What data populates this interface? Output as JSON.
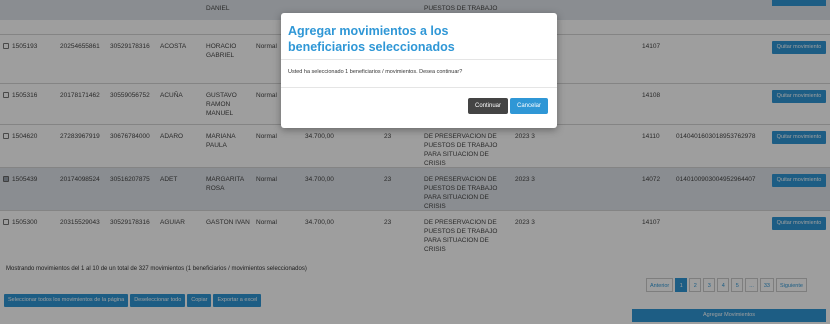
{
  "top_row": {
    "name": "DANIEL",
    "program": "PUESTOS DE TRABAJO"
  },
  "rows": [
    {
      "id": "1505193",
      "cuil": "20254655861",
      "cuit": "30529178316",
      "apellido": "ACOSTA",
      "nombre": [
        "HORACIO",
        "GABRIEL"
      ],
      "tipo": "Normal",
      "monto": "",
      "cod": "",
      "programa": [],
      "periodo": "",
      "codigo": "14107",
      "cbu": "",
      "selected": false
    },
    {
      "id": "1505316",
      "cuil": "20178171462",
      "cuit": "30559056752",
      "apellido": "ACUÑA",
      "nombre": [
        "GUSTAVO",
        "RAMON",
        "MANUEL"
      ],
      "tipo": "Normal",
      "monto": "",
      "cod": "",
      "programa": [],
      "periodo": "",
      "codigo": "14108",
      "cbu": "",
      "selected": false
    },
    {
      "id": "1504620",
      "cuil": "27283967919",
      "cuit": "30676784000",
      "apellido": "ADARO",
      "nombre": [
        "MARIANA",
        "PAULA"
      ],
      "tipo": "Normal",
      "monto": "34.700,00",
      "cod": "23",
      "programa": [
        "DE PRESERVACION DE",
        "PUESTOS DE TRABAJO",
        "PARA SITUACION DE",
        "CRISIS"
      ],
      "periodo": "2023   3",
      "codigo": "14110",
      "cbu": "0140401603018953762978",
      "selected": false
    },
    {
      "id": "1505439",
      "cuil": "20174098524",
      "cuit": "30516207875",
      "apellido": "ADET",
      "nombre": [
        "MARGARITA",
        "ROSA"
      ],
      "tipo": "Normal",
      "monto": "34.700,00",
      "cod": "23",
      "programa": [
        "DE PRESERVACION DE",
        "PUESTOS DE TRABAJO",
        "PARA SITUACION DE",
        "CRISIS"
      ],
      "periodo": "2023   3",
      "codigo": "14072",
      "cbu": "0140100903004952964407",
      "selected": true
    },
    {
      "id": "1505300",
      "cuil": "20315529043",
      "cuit": "30529178316",
      "apellido": "AGUIAR",
      "nombre": [
        "GASTON IVAN"
      ],
      "tipo": "Normal",
      "monto": "34.700,00",
      "cod": "23",
      "programa": [
        "DE PRESERVACION DE",
        "PUESTOS DE TRABAJO",
        "PARA SITUACION DE",
        "CRISIS"
      ],
      "periodo": "2023   3",
      "codigo": "14107",
      "cbu": "",
      "selected": false
    }
  ],
  "quitar_label": "Quitar movimiento",
  "footer_info": "Mostrando movimientos del 1 al 10 de un total de 327 movimientos (1 beneficiarios / movimientos seleccionados)",
  "pager": {
    "prev": "Anterior",
    "pages": [
      "1",
      "2",
      "3",
      "4",
      "5",
      "...",
      "33"
    ],
    "next": "Siguiente",
    "active": "1"
  },
  "buttons": {
    "select_all": "Seleccionar todos los movimientos de la página",
    "deselect_all": "Deseleccionar todo",
    "copy": "Copiar",
    "export": "Exportar a excel",
    "add": "Agregar Movimientos"
  },
  "modal": {
    "title": "Agregar movimientos a los beneficiarios seleccionados",
    "body": "Usted ha seleccionado 1 beneficiarios / movimientos. Desea continuar?",
    "continue": "Continuar",
    "cancel": "Cancelar"
  },
  "colors": {
    "accent": "#2f97d6",
    "selected_row": "#dfe4ea",
    "dark_button": "#444444"
  }
}
